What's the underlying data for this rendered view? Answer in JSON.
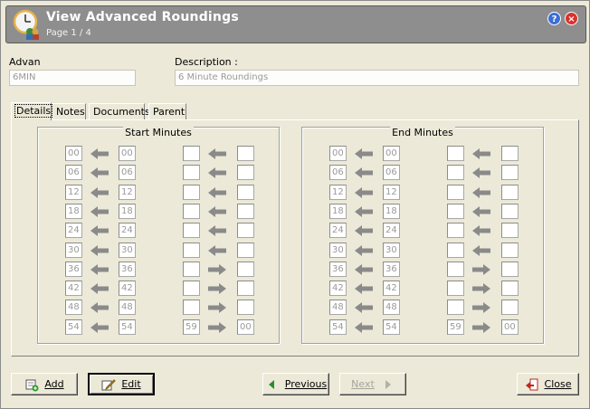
{
  "window": {
    "title": "View Advanced Roundings",
    "page": "Page 1 / 4",
    "help_icon": "?",
    "close_icon": "×"
  },
  "fields": {
    "code_label": "Advan",
    "code_value": "6MIN",
    "description_label": "Description :",
    "description_value": "6 Minute Roundings"
  },
  "tabs": [
    "Details",
    "Notes",
    "Documents",
    "Parent"
  ],
  "start_minutes": {
    "title": "Start Minutes",
    "rows": [
      {
        "from": "00",
        "to": "00",
        "range_from": "",
        "range_to": "",
        "dir": "left"
      },
      {
        "from": "06",
        "to": "06",
        "range_from": "",
        "range_to": "",
        "dir": "left"
      },
      {
        "from": "12",
        "to": "12",
        "range_from": "",
        "range_to": "",
        "dir": "left"
      },
      {
        "from": "18",
        "to": "18",
        "range_from": "",
        "range_to": "",
        "dir": "left"
      },
      {
        "from": "24",
        "to": "24",
        "range_from": "",
        "range_to": "",
        "dir": "left"
      },
      {
        "from": "30",
        "to": "30",
        "range_from": "",
        "range_to": "",
        "dir": "left"
      },
      {
        "from": "36",
        "to": "36",
        "range_from": "",
        "range_to": "",
        "dir": "right"
      },
      {
        "from": "42",
        "to": "42",
        "range_from": "",
        "range_to": "",
        "dir": "right"
      },
      {
        "from": "48",
        "to": "48",
        "range_from": "",
        "range_to": "",
        "dir": "right"
      },
      {
        "from": "54",
        "to": "54",
        "range_from": "59",
        "range_to": "00",
        "dir": "right"
      }
    ]
  },
  "end_minutes": {
    "title": "End Minutes",
    "rows": [
      {
        "from": "00",
        "to": "00",
        "range_from": "",
        "range_to": "",
        "dir": "left"
      },
      {
        "from": "06",
        "to": "06",
        "range_from": "",
        "range_to": "",
        "dir": "left"
      },
      {
        "from": "12",
        "to": "12",
        "range_from": "",
        "range_to": "",
        "dir": "left"
      },
      {
        "from": "18",
        "to": "18",
        "range_from": "",
        "range_to": "",
        "dir": "left"
      },
      {
        "from": "24",
        "to": "24",
        "range_from": "",
        "range_to": "",
        "dir": "left"
      },
      {
        "from": "30",
        "to": "30",
        "range_from": "",
        "range_to": "",
        "dir": "left"
      },
      {
        "from": "36",
        "to": "36",
        "range_from": "",
        "range_to": "",
        "dir": "right"
      },
      {
        "from": "42",
        "to": "42",
        "range_from": "",
        "range_to": "",
        "dir": "right"
      },
      {
        "from": "48",
        "to": "48",
        "range_from": "",
        "range_to": "",
        "dir": "right"
      },
      {
        "from": "54",
        "to": "54",
        "range_from": "59",
        "range_to": "00",
        "dir": "right"
      }
    ]
  },
  "buttons": {
    "add": "Add",
    "edit": "Edit",
    "previous": "Previous",
    "next": "Next",
    "close": "Close"
  },
  "colors": {
    "header_bg": "#8e8e8e",
    "window_bg": "#ece9d8",
    "arrow": "#8a8a8a"
  }
}
